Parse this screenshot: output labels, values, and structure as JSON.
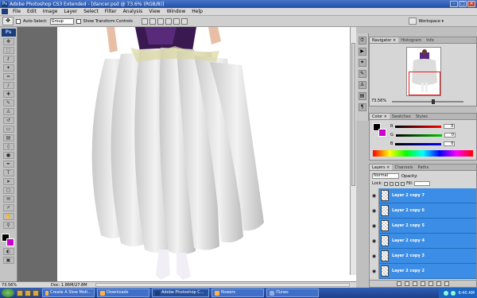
{
  "window": {
    "title": "Adobe Photoshop CS3 Extended - [dancer.psd @ 73.6% (RGB/8)]"
  },
  "menu": [
    "File",
    "Edit",
    "Image",
    "Layer",
    "Select",
    "Filter",
    "Analysis",
    "View",
    "Window",
    "Help"
  ],
  "options_bar": {
    "auto_select_label": "Auto-Select:",
    "auto_select_value": "Group",
    "show_transform_label": "Show Transform Controls",
    "workspace_label": "Workspace ▾"
  },
  "status": {
    "zoom": "73.56%",
    "doc": "Doc: 1.86M/27.8M"
  },
  "navigator": {
    "tabs": [
      "Navigator ×",
      "Histogram",
      "Info"
    ],
    "zoom": "73.56%"
  },
  "color_panel": {
    "tabs": [
      "Color ×",
      "Swatches",
      "Styles"
    ],
    "channels": [
      {
        "label": "R",
        "value": "0",
        "color": "#cc0000"
      },
      {
        "label": "G",
        "value": "0",
        "color": "#00aa00"
      },
      {
        "label": "B",
        "value": "0",
        "color": "#0000cc"
      }
    ]
  },
  "layers_panel": {
    "tabs": [
      "Layers ×",
      "Channels",
      "Paths"
    ],
    "blend_mode": "Normal",
    "opacity_label": "Opacity:",
    "lock_label": "Lock:",
    "fill_label": "Fill:",
    "layers": [
      "Layer 2 copy 7",
      "Layer 2 copy 6",
      "Layer 2 copy 5",
      "Layer 2 copy 4",
      "Layer 2 copy 3",
      "Layer 2 copy 2"
    ],
    "selection_color": "#3b8de6"
  },
  "taskbar": {
    "tasks": [
      "Create A Slow Moti...",
      "Downloads",
      "Adobe Photoshop C...",
      "flowers",
      "iTunes"
    ],
    "clock": "6:40 AM"
  }
}
